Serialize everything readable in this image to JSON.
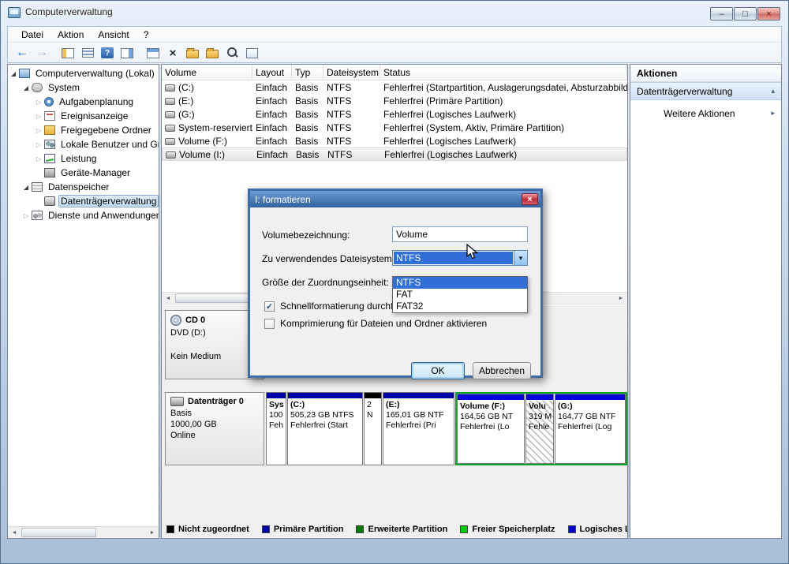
{
  "colors": {
    "unallocated": "#000000",
    "primary_partition": "#0000A8",
    "extended_partition": "#00A426",
    "free_space": "#00CE00",
    "logical_drive": "#0000DE",
    "selection": "#2F6FD6"
  },
  "window": {
    "title": "Computerverwaltung",
    "minimize": "–",
    "maximize": "□",
    "close": "×"
  },
  "menubar": {
    "items": [
      "Datei",
      "Aktion",
      "Ansicht",
      "?"
    ]
  },
  "tree": {
    "items": [
      {
        "label": "Computerverwaltung (Lokal)"
      },
      {
        "label": "System"
      },
      {
        "label": "Aufgabenplanung"
      },
      {
        "label": "Ereignisanzeige"
      },
      {
        "label": "Freigegebene Ordner"
      },
      {
        "label": "Lokale Benutzer und Gruppen"
      },
      {
        "label": "Leistung"
      },
      {
        "label": "Geräte-Manager"
      },
      {
        "label": "Datenspeicher"
      },
      {
        "label": "Datenträgerverwaltung"
      },
      {
        "label": "Dienste und Anwendungen"
      }
    ]
  },
  "volume_list": {
    "columns": [
      "Volume",
      "Layout",
      "Typ",
      "Dateisystem",
      "Status"
    ],
    "rows": [
      [
        "(C:)",
        "Einfach",
        "Basis",
        "NTFS",
        "Fehlerfrei (Startpartition, Auslagerungsdatei, Absturzabbild"
      ],
      [
        "(E:)",
        "Einfach",
        "Basis",
        "NTFS",
        "Fehlerfrei (Primäre Partition)"
      ],
      [
        "(G:)",
        "Einfach",
        "Basis",
        "NTFS",
        "Fehlerfrei (Logisches Laufwerk)"
      ],
      [
        "System-reserviert",
        "Einfach",
        "Basis",
        "NTFS",
        "Fehlerfrei (System, Aktiv, Primäre Partition)"
      ],
      [
        "Volume (F:)",
        "Einfach",
        "Basis",
        "NTFS",
        "Fehlerfrei (Logisches Laufwerk)"
      ],
      [
        "Volume (I:)",
        "Einfach",
        "Basis",
        "NTFS",
        "Fehlerfrei (Logisches Laufwerk)"
      ]
    ]
  },
  "cd": {
    "name": "CD 0",
    "drive": "DVD (D:)",
    "status": "Kein Medium"
  },
  "disk0": {
    "name": "Datenträger 0",
    "type": "Basis",
    "size": "1000,00 GB",
    "status": "Online",
    "partitions": [
      {
        "lines": [
          "Sys",
          "100",
          "Feh"
        ],
        "strip": "#0000A8"
      },
      {
        "lines": [
          "(C:)",
          "505,23 GB NTFS",
          "Fehlerfrei (Start"
        ],
        "strip": "#0000A8"
      },
      {
        "lines": [
          "2",
          "N",
          ""
        ],
        "strip": "#000000"
      },
      {
        "lines": [
          "(E:)",
          "165,01 GB NTF",
          "Fehlerfrei (Pri"
        ],
        "strip": "#0000A8"
      },
      {
        "lines": [
          "Volume  (F:)",
          "164,56 GB NT",
          "Fehlerfrei (Lo"
        ],
        "strip": "#0000DE"
      },
      {
        "lines": [
          "Volu",
          "319 M",
          "Fehle"
        ],
        "strip": "#0000DE"
      },
      {
        "lines": [
          "(G:)",
          "164,77 GB NTF",
          "Fehlerfrei (Log"
        ],
        "strip": "#0000DE"
      }
    ]
  },
  "legend": {
    "items": [
      {
        "label": "Nicht zugeordnet",
        "color": "#000000"
      },
      {
        "label": "Primäre Partition",
        "color": "#0000A8"
      },
      {
        "label": "Erweiterte Partition",
        "color": "#007A00"
      },
      {
        "label": "Freier Speicherplatz",
        "color": "#00CE00"
      },
      {
        "label": "Logisches Laufwerk",
        "color": "#0000DE"
      }
    ]
  },
  "actions": {
    "title": "Aktionen",
    "item": "Datenträgerverwaltung",
    "more": "Weitere Aktionen"
  },
  "dialog": {
    "title": "I: formatieren",
    "label_volume": "Volumebezeichnung:",
    "value_volume": "Volume",
    "label_fs": "Zu verwendendes Dateisystem:",
    "value_fs": "NTFS",
    "label_alloc": "Größe der Zuordnungseinheit:",
    "options": [
      "NTFS",
      "FAT",
      "FAT32"
    ],
    "check_quick": "Schnellformatierung durchführen",
    "check_compress": "Komprimierung für Dateien und Ordner aktivieren",
    "ok": "OK",
    "cancel": "Abbrechen"
  }
}
